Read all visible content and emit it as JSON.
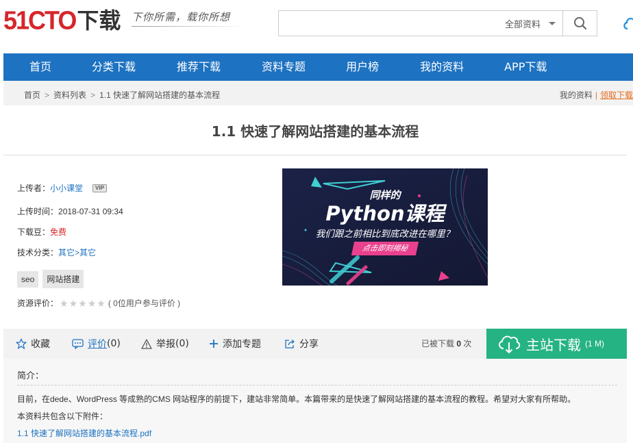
{
  "header": {
    "logo_brand": "51CTO",
    "logo_suffix": "下载",
    "slogan": "下你所需，载你所想",
    "search": {
      "placeholder": "",
      "value": "",
      "category": "全部资料"
    }
  },
  "nav": {
    "items": [
      {
        "label": "首页"
      },
      {
        "label": "分类下载"
      },
      {
        "label": "推荐下载"
      },
      {
        "label": "资料专题"
      },
      {
        "label": "用户榜"
      },
      {
        "label": "我的资料"
      },
      {
        "label": "APP下载"
      }
    ]
  },
  "breadcrumb": {
    "items": [
      "首页",
      "资料列表",
      "1.1 快速了解网站搭建的基本流程"
    ],
    "separator": ">",
    "my_materials": "我的资料",
    "divider": "|",
    "get_download": "领取下载"
  },
  "page_title": "1.1 快速了解网站搭建的基本流程",
  "info": {
    "uploader_label": "上传者：",
    "uploader_name": "小小课堂",
    "vip_badge": "VIP",
    "upload_time_label": "上传时间：",
    "upload_time": "2018-07-31 09:34",
    "beans_label": "下载豆：",
    "beans_value": "免费",
    "category_label": "技术分类：",
    "category_value": "其它>其它",
    "tags": [
      "seo",
      "网站搭建"
    ],
    "rating_label": "资源评价：",
    "rating_stars": 0,
    "rating_max": 5,
    "rating_text": "( 0位用户参与评价 )"
  },
  "banner": {
    "line1": "同样的",
    "line2": "Python课程",
    "line3": "我们跟之前相比到底改进在哪里？",
    "button": "点击即刻揭秘"
  },
  "actions": {
    "favorite": "收藏",
    "comment": "评价",
    "comment_count": "(0)",
    "report": "举报",
    "report_count": "(0)",
    "add_topic": "添加专题",
    "share": "分享",
    "download_count_prefix": "已被下载",
    "download_count": "0",
    "download_count_suffix": "次",
    "main_download": "主站下载",
    "file_size": "(1 M)"
  },
  "intro": {
    "label": "简介：",
    "text": "目前，在dede、WordPress 等成熟的CMS 网站程序的前提下，建站非常简单。本篇带来的是快速了解网站搭建的基本流程的教程。希望对大家有所帮助。",
    "attachments_label": "本资料共包含以下附件：",
    "attachment": "1.1 快速了解网站搭建的基本流程.pdf"
  },
  "colors": {
    "brand_red": "#d6262b",
    "nav_blue": "#1d72c1",
    "download_green": "#26b383",
    "banner_pink": "#e9418d",
    "link_orange": "#e76b1a"
  }
}
